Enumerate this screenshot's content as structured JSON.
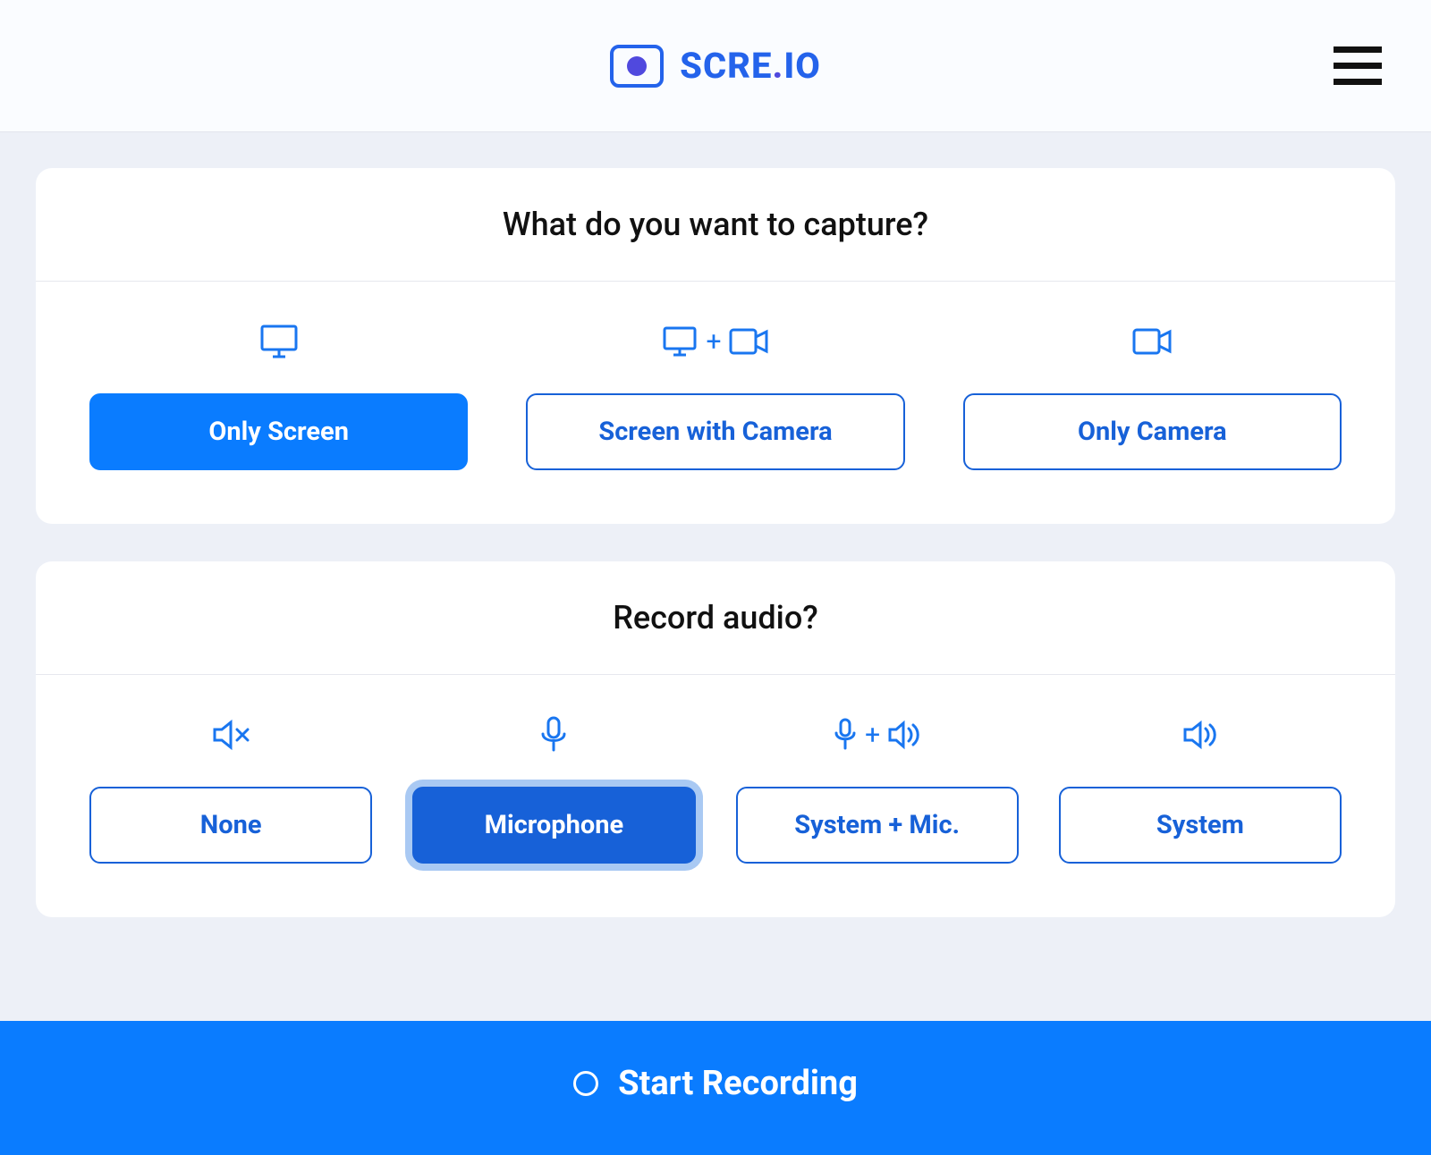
{
  "header": {
    "logo_text_primary": "SCRE",
    "logo_text_dot": ".",
    "logo_text_secondary": "IO"
  },
  "capture": {
    "heading": "What do you want to capture?",
    "options": [
      {
        "label": "Only Screen",
        "selected": true
      },
      {
        "label": "Screen with Camera",
        "selected": false
      },
      {
        "label": "Only Camera",
        "selected": false
      }
    ]
  },
  "audio": {
    "heading": "Record audio?",
    "options": [
      {
        "label": "None",
        "selected": false
      },
      {
        "label": "Microphone",
        "selected": true
      },
      {
        "label": "System + Mic.",
        "selected": false
      },
      {
        "label": "System",
        "selected": false
      }
    ]
  },
  "footer": {
    "start_label": "Start Recording"
  },
  "colors": {
    "accent_blue": "#0a7cff",
    "brand_blue": "#2463eb",
    "brand_purple": "#5049de",
    "button_border": "#1761d8",
    "bg_page": "#edf0f7",
    "bg_header": "#fafcff"
  }
}
